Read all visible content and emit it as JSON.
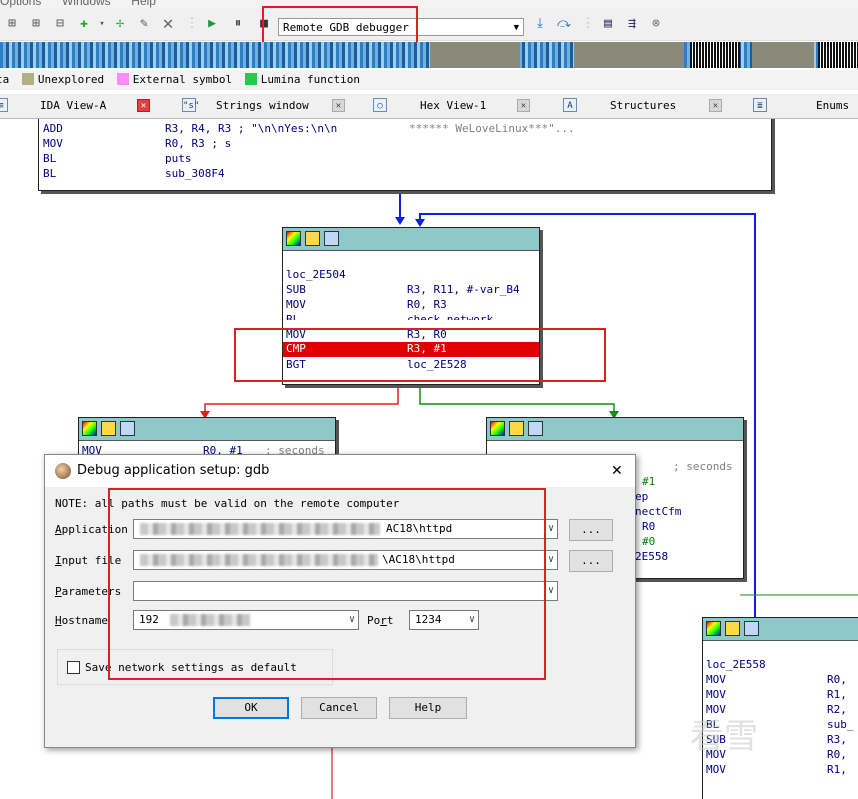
{
  "menubar": {
    "items": [
      "Options",
      "Windows",
      "Help"
    ]
  },
  "toolbar": {
    "debugger_select": "Remote GDB debugger"
  },
  "legend": [
    {
      "label": "Data",
      "color": "#b4b47c"
    },
    {
      "label": "Unexplored",
      "color": "#b0b080"
    },
    {
      "label": "External symbol",
      "color": "#ff8cff"
    },
    {
      "label": "Lumina function",
      "color": "#2cc84c"
    }
  ],
  "tabs": [
    {
      "label": "IDA View-A",
      "icon": "ida-icon"
    },
    {
      "label": "Strings window",
      "icon": "strings-icon"
    },
    {
      "label": "Hex View-1",
      "icon": "hex-icon"
    },
    {
      "label": "Structures",
      "icon": "structures-icon"
    },
    {
      "label": "Enums",
      "icon": "enums-icon"
    }
  ],
  "nodes": {
    "top": {
      "rows": [
        {
          "mn": "ADD",
          "op": "R3, R4, R3 ; \"\\n\\nYes:\\n\\n",
          "cmt": "****** WeLoveLinux***\"..."
        },
        {
          "mn": "MOV",
          "op": "R0, R3  ; s",
          "cmt": ""
        },
        {
          "mn": "BL",
          "op": "puts",
          "cmt": ""
        },
        {
          "mn": "BL",
          "op": "sub_308F4",
          "cmt": ""
        }
      ]
    },
    "center": {
      "label": "loc_2E504",
      "rows": [
        {
          "mn": "SUB",
          "op": "R3, R11, #-var_B4"
        },
        {
          "mn": "MOV",
          "op": "R0, R3"
        },
        {
          "mn": "BL",
          "op": "check_network"
        },
        {
          "mn": "MOV",
          "op": "R3, R0"
        },
        {
          "mn": "CMP",
          "op": "R3, #1"
        },
        {
          "mn": "BGT",
          "op": "loc_2E528"
        }
      ]
    },
    "left": {
      "first": {
        "mn": "MOV",
        "op": "R0, #1",
        "cmt": "; seconds"
      }
    },
    "right": {
      "rows": [
        "; seconds",
        "#1",
        "ep",
        "nectCfm",
        "R0",
        "#0",
        "2E558"
      ]
    },
    "bottom_right": {
      "label": "loc_2E558",
      "rows": [
        {
          "mn": "MOV",
          "op": "R0,"
        },
        {
          "mn": "MOV",
          "op": "R1,"
        },
        {
          "mn": "MOV",
          "op": "R2,"
        },
        {
          "mn": "BL",
          "op": "sub_"
        },
        {
          "mn": "SUB",
          "op": "R3,"
        },
        {
          "mn": "MOV",
          "op": "R0,"
        },
        {
          "mn": "MOV",
          "op": "R1,"
        }
      ]
    }
  },
  "dialog": {
    "title": "Debug application setup: gdb",
    "note": "NOTE: all paths must be valid on the remote computer",
    "application": {
      "label": "Application",
      "value_suffix": "AC18\\httpd",
      "browse": "..."
    },
    "input_file": {
      "label": "Input file",
      "value_suffix": "\\AC18\\httpd",
      "browse": "..."
    },
    "parameters": {
      "label": "Parameters",
      "value": ""
    },
    "hostname": {
      "label": "Hostname",
      "value": "192"
    },
    "port": {
      "label": "Port",
      "value": "1234"
    },
    "save_default": {
      "label": "Save network settings as default",
      "checked": false
    },
    "buttons": {
      "ok": "OK",
      "cancel": "Cancel",
      "help": "Help"
    }
  },
  "watermark": "看雪"
}
